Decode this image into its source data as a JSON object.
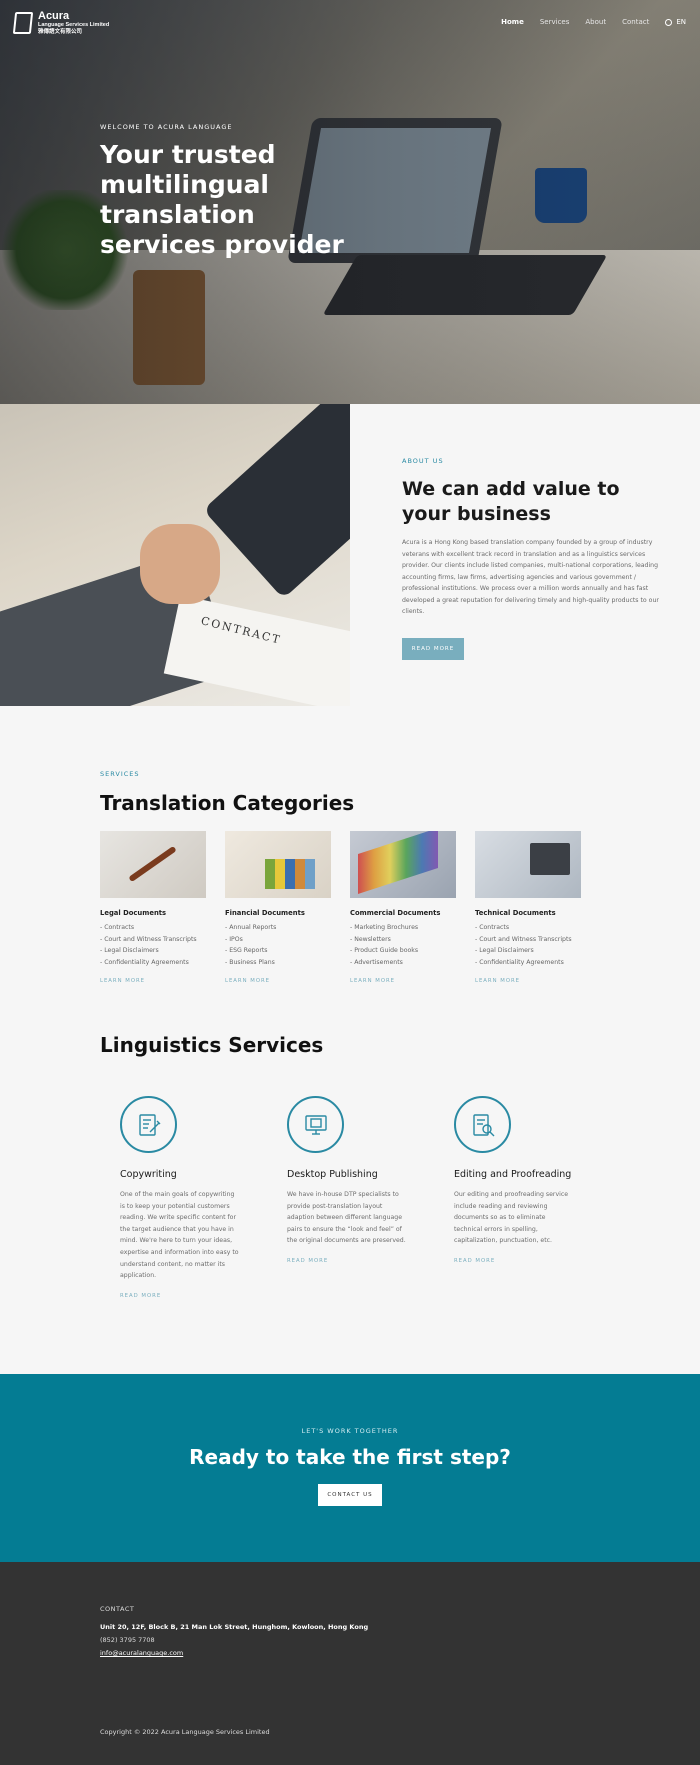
{
  "brand": {
    "name": "Acura",
    "tagline": "Language Services Limited",
    "chinese": "雅傳語文有限公司"
  },
  "nav": {
    "items": [
      "Home",
      "Services",
      "About",
      "Contact"
    ],
    "language": "EN"
  },
  "hero": {
    "kicker": "WELCOME TO ACURA LANGUAGE",
    "title": "Your trusted multilingual translation services provider"
  },
  "about": {
    "kicker": "ABOUT US",
    "title": "We can add value to your business",
    "body": "Acura is a Hong Kong based translation company founded by a group of industry veterans with excellent track record in translation and as a linguistics services provider. Our clients include listed companies, multi-national corporations, leading accounting firms, law firms, advertising agencies and various government / professional institutions. We process over a million words annually and has fast developed a great reputation for delivering timely and high-quality products to our clients.",
    "button": "READ MORE",
    "image_text": "CONTRACT"
  },
  "services": {
    "kicker": "SERVICES",
    "title": "Translation Categories",
    "cards": [
      {
        "title": "Legal Documents",
        "items": [
          "- Contracts",
          "- Court and Witness Transcripts",
          "- Legal Disclaimers",
          "- Confidentiality Agreements"
        ],
        "more": "LEARN MORE"
      },
      {
        "title": "Financial Documents",
        "items": [
          "- Annual Reports",
          "- IPOs",
          "- ESG Reports",
          "- Business Plans"
        ],
        "more": "LEARN MORE"
      },
      {
        "title": "Commercial Documents",
        "items": [
          "- Marketing Brochures",
          "- Newsletters",
          "- Product Guide books",
          "- Advertisements"
        ],
        "more": "LEARN MORE"
      },
      {
        "title": "Technical Documents",
        "items": [
          "- Contracts",
          "- Court and Witness Transcripts",
          "- Legal Disclaimers",
          "- Confidentiality Agreements"
        ],
        "more": "LEARN MORE"
      }
    ]
  },
  "linguistics": {
    "title": "Linguistics Services",
    "cards": [
      {
        "icon": "copywriting-icon",
        "title": "Copywriting",
        "body": "One of the main goals of copywriting is to keep your potential customers reading. We write specific content for the target audience that you have in mind. We're here to turn your ideas, expertise and information into easy to understand content, no matter its application.",
        "more": "READ MORE"
      },
      {
        "icon": "desktop-publishing-icon",
        "title": "Desktop Publishing",
        "body": "We have in-house DTP specialists to provide post-translation layout adaption between different language pairs to ensure the “look and feel” of the original documents are preserved.",
        "more": "READ MORE"
      },
      {
        "icon": "proofreading-icon",
        "title": "Editing and Proofreading",
        "body": "Our editing and proofreading service include reading and reviewing documents so as to eliminate technical errors in spelling, capitalization, punctuation, etc.",
        "more": "READ MORE"
      }
    ]
  },
  "cta": {
    "kicker": "LET'S WORK TOGETHER",
    "title": "Ready to take the first step?",
    "button": "CONTACT US"
  },
  "footer": {
    "label": "CONTACT",
    "address": "Unit 20, 12F, Block B, 21 Man Lok Street, Hunghom, Kowloon, Hong Kong",
    "phone": "(852) 3795 7708",
    "email": "info@acuralanguage.com",
    "copyright": "Copyright © 2022 Acura Language Services Limited"
  },
  "colors": {
    "accent": "#047c93",
    "button": "#79aebe",
    "footer": "#333333",
    "background": "#f6f6f6"
  }
}
